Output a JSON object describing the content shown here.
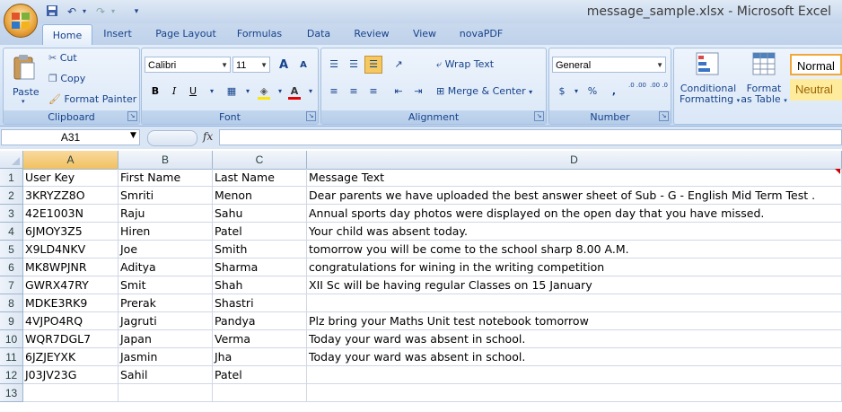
{
  "window": {
    "title": "message_sample.xlsx - Microsoft Excel"
  },
  "qat": {
    "save_icon": "save-icon",
    "undo_icon": "undo-icon",
    "redo_icon": "redo-icon",
    "customize_icon": "chevron-down-icon"
  },
  "tabs": [
    "Home",
    "Insert",
    "Page Layout",
    "Formulas",
    "Data",
    "Review",
    "View",
    "novaPDF"
  ],
  "clipboard": {
    "paste": "Paste",
    "cut": "Cut",
    "copy": "Copy",
    "format_painter": "Format Painter",
    "label": "Clipboard"
  },
  "font": {
    "name": "Calibri",
    "size": "11",
    "bold": "B",
    "italic": "I",
    "underline": "U",
    "grow": "A",
    "shrink": "A",
    "label": "Font"
  },
  "alignment": {
    "wrap_text": "Wrap Text",
    "merge_center": "Merge & Center",
    "label": "Alignment"
  },
  "number": {
    "format": "General",
    "currency": "$",
    "percent": "%",
    "comma": ",",
    "inc_dec": ".0 .00",
    "dec_dec": ".00 .0",
    "label": "Number"
  },
  "styles": {
    "conditional_line1": "Conditional",
    "conditional_line2": "Formatting",
    "table_line1": "Format",
    "table_line2": "as Table",
    "normal": "Normal",
    "neutral": "Neutral"
  },
  "formula_bar": {
    "name_box": "A31",
    "fx": "fx",
    "value": ""
  },
  "columns": [
    "A",
    "B",
    "C",
    "D"
  ],
  "selected_column": "A",
  "rows": [
    {
      "num": "1",
      "cells": [
        "User Key",
        "First Name",
        "Last Name",
        "Message Text"
      ]
    },
    {
      "num": "2",
      "cells": [
        "3KRYZZ8O",
        "Smriti",
        "Menon",
        "Dear parents we have uploaded the best answer sheet of Sub -  G - English  Mid Term Test ."
      ]
    },
    {
      "num": "3",
      "cells": [
        "42E1003N",
        "Raju",
        "Sahu",
        "Annual sports day photos were displayed on the open day that you have missed."
      ]
    },
    {
      "num": "4",
      "cells": [
        "6JMOY3Z5",
        "Hiren",
        "Patel",
        "Your child was absent today."
      ]
    },
    {
      "num": "5",
      "cells": [
        "X9LD4NKV",
        "Joe",
        "Smith",
        "tomorrow you will be come to the school sharp 8.00 A.M."
      ]
    },
    {
      "num": "6",
      "cells": [
        "MK8WPJNR",
        "Aditya",
        "Sharma",
        "congratulations for wining in the writing competition"
      ]
    },
    {
      "num": "7",
      "cells": [
        "GWRX47RY",
        "Smit",
        "Shah",
        "XII Sc will be having regular Classes on 15 January"
      ]
    },
    {
      "num": "8",
      "cells": [
        "MDKE3RK9",
        "Prerak",
        "Shastri",
        ""
      ]
    },
    {
      "num": "9",
      "cells": [
        "4VJPO4RQ",
        "Jagruti",
        "Pandya",
        "Plz bring your Maths Unit test notebook tomorrow"
      ]
    },
    {
      "num": "10",
      "cells": [
        "WQR7DGL7",
        "Japan",
        "Verma",
        "Today your ward was absent in school."
      ]
    },
    {
      "num": "11",
      "cells": [
        "6JZJEYXK",
        "Jasmin",
        "Jha",
        "Today your ward was absent in school."
      ]
    },
    {
      "num": "12",
      "cells": [
        "J03JV23G",
        "Sahil",
        "Patel",
        ""
      ]
    },
    {
      "num": "13",
      "cells": [
        "",
        "",
        "",
        ""
      ]
    }
  ],
  "colors": {
    "accent": "#15428b",
    "selected_header": "#f6cf7f",
    "normal_style_border": "#f0a83b",
    "neutral_style": "#ffeb9c"
  }
}
